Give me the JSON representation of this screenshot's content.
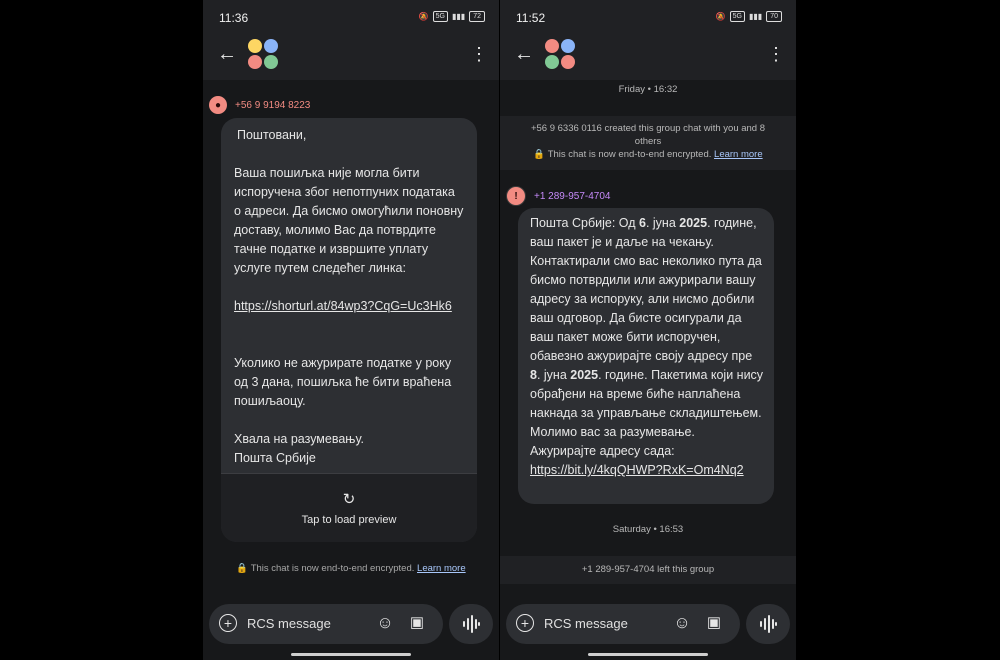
{
  "left": {
    "status_time": "11:36",
    "battery": "72",
    "sender": "+56 9 9194 8223",
    "message_paragraphs": [
      "Поштовани,",
      "Ваша пошиљка није могла бити испоручена због непотпуних података о адреси. Да бисмо омогућили поновну доставу, молимо Вас да потврдите тачне податке и извршите уплату услуге путем следећег линка:",
      "https://shorturl.at/84wp3?CqG=Uc3Hk6",
      "Уколико не ажурирате податке у року од 3 дана, пошиљка ће бити враћена пошиљаоцу.",
      "Хвала на разумевању.",
      "Пошта Србије"
    ],
    "preview_label": "Tap to load preview",
    "encryption_note": "This chat is now end-to-end encrypted.",
    "learn_more": "Learn more",
    "input_placeholder": "RCS message"
  },
  "right": {
    "status_time": "11:52",
    "battery": "70",
    "date_top": "Friday • 16:32",
    "created_note": "+56 9 6336 0116 created this group chat with you and 8 others",
    "encryption_note": "This chat is now end-to-end encrypted.",
    "learn_more": "Learn more",
    "sender": "+1 289-957-4704",
    "message": {
      "t1": "Пошта Србије: Од ",
      "b1": "6",
      "t2": ". јуна ",
      "b2": "2025",
      "t3": ". године, ваш пакет је и даље на чекању. Контактирали смо вас неколико пута да бисмо потврдили или ажурирали вашу адресу за испоруку, али нисмо добили ваш одговор. Да бисте осигурали да ваш пакет може бити испоручен, обавезно ажурирајте своју адресу пре ",
      "b3": "8",
      "t4": ". јуна ",
      "b4": "2025",
      "t5": ". године. Пакетима који нису обрађени на време биће наплаћена накнада за управљање складиштењем. Молимо вас за разумевање. Ажурирајте адресу сада:",
      "link": "https://bit.ly/4kqQHWP?RxK=Om4Nq2"
    },
    "date_bottom": "Saturday • 16:53",
    "left_note": "+1 289-957-4704 left this group",
    "input_placeholder": "RCS message"
  },
  "colors": {
    "sender_left": "#f28b82",
    "sender_right": "#c58af9",
    "avatar_dots": [
      "#fdd663",
      "#8ab4f8",
      "#f28b82",
      "#81c995"
    ]
  }
}
